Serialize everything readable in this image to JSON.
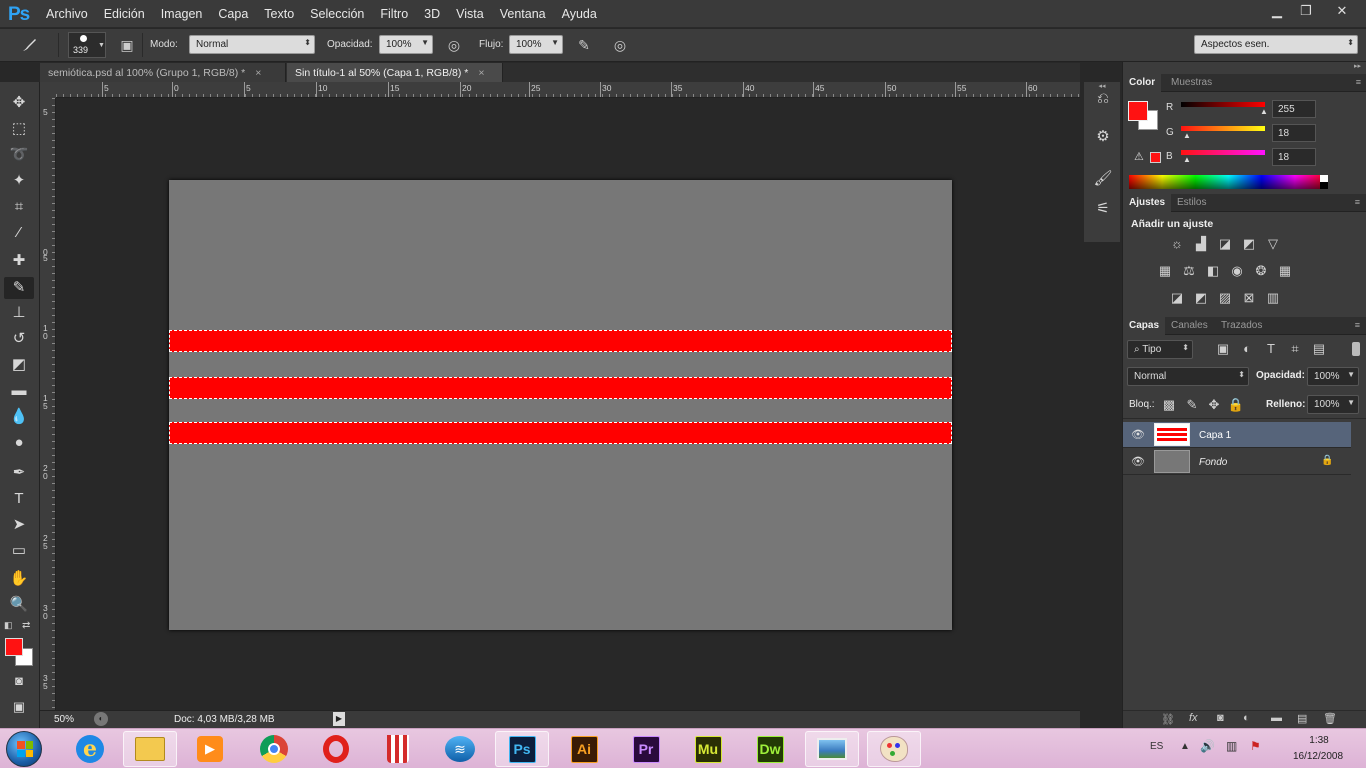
{
  "app": {
    "logo": "Ps"
  },
  "menu": [
    "Archivo",
    "Edición",
    "Imagen",
    "Capa",
    "Texto",
    "Selección",
    "Filtro",
    "3D",
    "Vista",
    "Ventana",
    "Ayuda"
  ],
  "window_controls": {
    "minimize": "▁",
    "restore": "❐",
    "close": "✕"
  },
  "options": {
    "brush_size": "339",
    "mode_label": "Modo:",
    "mode_value": "Normal",
    "opacity_label": "Opacidad:",
    "opacity_value": "100%",
    "flow_label": "Flujo:",
    "flow_value": "100%",
    "workspace": "Aspectos esen."
  },
  "tabs": [
    {
      "label": "semiótica.psd al 100% (Grupo 1, RGB/8) *",
      "close": "×"
    },
    {
      "label": "Sin título-1 al 50% (Capa 1, RGB/8) *",
      "close": "×"
    }
  ],
  "ruler_h": [
    "5",
    "0",
    "5",
    "10",
    "15",
    "20",
    "25",
    "30",
    "35",
    "40",
    "45",
    "50",
    "55",
    "60"
  ],
  "ruler_v": [
    "5",
    "0",
    "5",
    "1\n0",
    "1\n5",
    "2\n0",
    "2\n5",
    "3\n0",
    "3\n5"
  ],
  "status": {
    "zoom": "50%",
    "doc": "Doc: 4,03 MB/3,28 MB",
    "arrow": "▶"
  },
  "color_panel": {
    "tabs": [
      "Color",
      "Muestras"
    ],
    "r_label": "R",
    "g_label": "G",
    "b_label": "B",
    "r": "255",
    "g": "18",
    "b": "18",
    "foreground": "#ff1212"
  },
  "adjust_panel": {
    "tabs": [
      "Ajustes",
      "Estilos"
    ],
    "title": "Añadir un ajuste"
  },
  "layers_panel": {
    "tabs": [
      "Capas",
      "Canales",
      "Trazados"
    ],
    "filter": "Tipo",
    "blend": "Normal",
    "opacity_label": "Opacidad:",
    "opacity": "100%",
    "lock_label": "Bloq.:",
    "fill_label": "Relleno:",
    "fill": "100%",
    "layers": [
      {
        "name": "Capa 1",
        "selected": true
      },
      {
        "name": "Fondo",
        "locked": true
      }
    ]
  },
  "canvas": {
    "background": "#777777",
    "stripe_color": "#ff0000"
  },
  "taskbar": {
    "adobe_apps": [
      {
        "label": "Ps",
        "bg": "#0c1e3c",
        "fg": "#41b6f2"
      },
      {
        "label": "Ai",
        "bg": "#3a1c05",
        "fg": "#f7a022"
      },
      {
        "label": "Pr",
        "bg": "#2a0a3c",
        "fg": "#c98aff"
      },
      {
        "label": "Mu",
        "bg": "#2a2f05",
        "fg": "#d6e835"
      },
      {
        "label": "Dw",
        "bg": "#233a05",
        "fg": "#9ef03a"
      }
    ],
    "lang": "ES",
    "time": "1:38",
    "date": "16/12/2008"
  }
}
